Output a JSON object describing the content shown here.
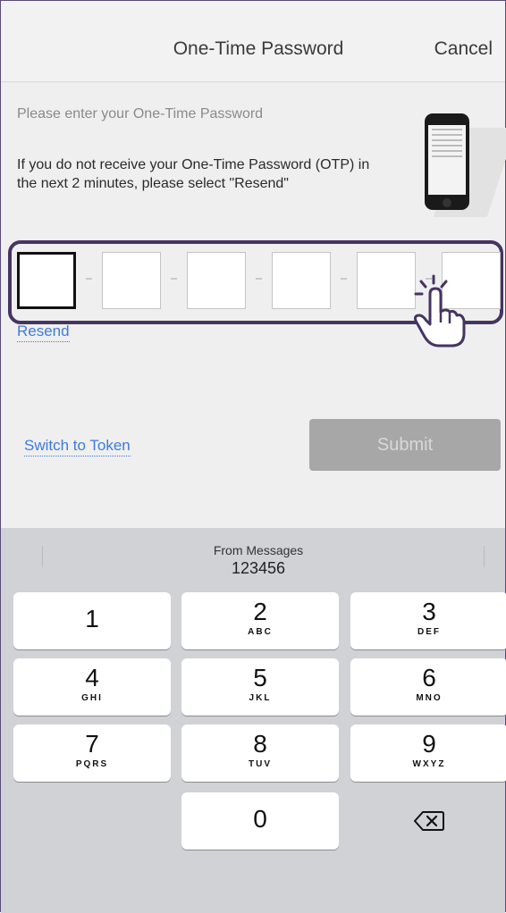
{
  "header": {
    "title": "One-Time Password",
    "cancel_label": "Cancel"
  },
  "body": {
    "prompt": "Please enter your One-Time Password",
    "info": "If you do not receive your One-Time Password (OTP) in the next 2 minutes, please select \"Resend\""
  },
  "otp": {
    "values": [
      "",
      "",
      "",
      "",
      "",
      ""
    ]
  },
  "links": {
    "resend": "Resend",
    "switch_to_token": "Switch to Token"
  },
  "submit_label": "Submit",
  "keyboard": {
    "suggestion_title": "From Messages",
    "suggestion_code": "123456",
    "keys": [
      {
        "digit": "1",
        "letters": ""
      },
      {
        "digit": "2",
        "letters": "ABC"
      },
      {
        "digit": "3",
        "letters": "DEF"
      },
      {
        "digit": "4",
        "letters": "GHI"
      },
      {
        "digit": "5",
        "letters": "JKL"
      },
      {
        "digit": "6",
        "letters": "MNO"
      },
      {
        "digit": "7",
        "letters": "PQRS"
      },
      {
        "digit": "8",
        "letters": "TUV"
      },
      {
        "digit": "9",
        "letters": "WXYZ"
      },
      {
        "digit": "0",
        "letters": ""
      }
    ]
  },
  "colors": {
    "accent": "#463462",
    "link": "#3f7bd9",
    "submit_disabled": "#a7a7a7"
  },
  "icons": {
    "phone": "phone-illustration",
    "cursor": "hand-pointer-icon",
    "delete": "backspace-icon"
  }
}
